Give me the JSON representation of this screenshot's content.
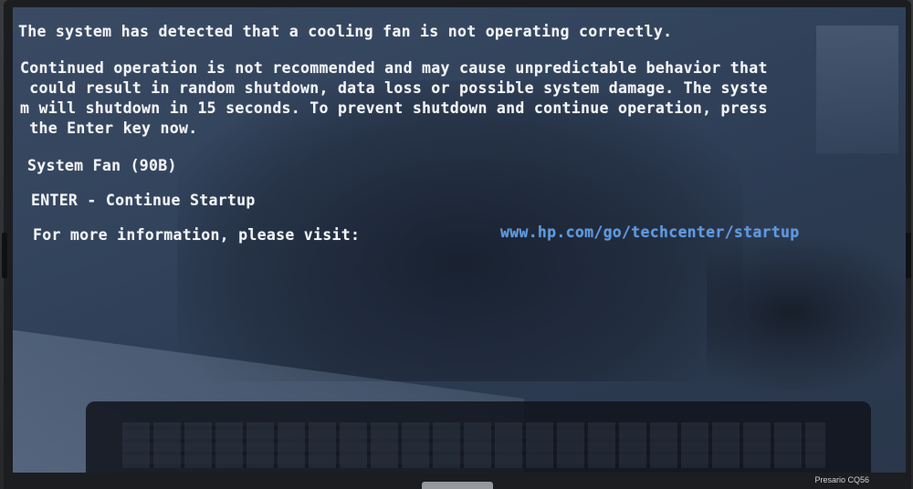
{
  "bios_warning": {
    "line1": "The system has detected that a cooling fan is not operating correctly.",
    "para_line1": "Continued operation is not recommended and may cause unpredictable behavior that",
    "para_line2": " could result in random shutdown, data loss or possible system damage. The syste",
    "para_line3": "m will shutdown in 15 seconds. To prevent shutdown and continue operation, press",
    "para_line4": " the Enter key now.",
    "fan_code": "System Fan (90B)",
    "enter_option": "ENTER - Continue Startup",
    "info_label": "For more information, please visit:",
    "info_url": "www.hp.com/go/techcenter/startup"
  },
  "device": {
    "model_label": "Presario CQ56"
  },
  "colors": {
    "screen_bg": "#32435c",
    "text": "#f2f4f7",
    "link": "#5a9ae6"
  }
}
